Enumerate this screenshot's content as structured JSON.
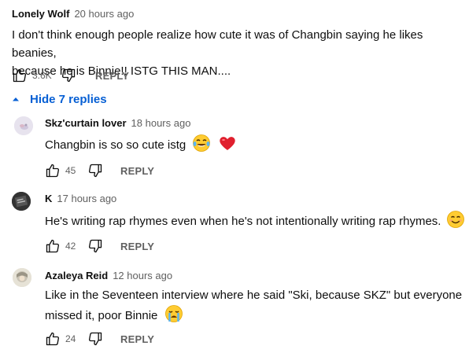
{
  "main_comment": {
    "author": "Lonely Wolf",
    "time": "20 hours ago",
    "text_line1": "I don't think enough people realize how cute it was of Changbin saying he likes beanies,",
    "text_line2": "because he is Binnie!! ISTG THIS MAN....",
    "likes": "3.6K",
    "reply_label": "REPLY"
  },
  "replies_toggle": {
    "label": "Hide 7 replies",
    "icon": "caret-up-icon"
  },
  "replies": [
    {
      "author": "Skz'curtain lover",
      "time": "18 hours ago",
      "text_line1": "Changbin is so so cute istg",
      "emojis": [
        "laughing-tears-emoji",
        "red-heart-emoji"
      ],
      "likes": "45",
      "reply_label": "REPLY"
    },
    {
      "author": "K",
      "time": "17 hours ago",
      "text_line1": "He's writing rap rhymes even when he's not intentionally writing rap rhymes.",
      "emojis": [
        "smiling-face-emoji"
      ],
      "likes": "42",
      "reply_label": "REPLY"
    },
    {
      "author": "Azaleya Reid",
      "time": "12 hours ago",
      "text_line1": "Like in the Seventeen interview where he said \"Ski, because SKZ\" but everyone",
      "text_line2": "missed it, poor Binnie",
      "emojis": [
        "crying-face-emoji"
      ],
      "likes": "24",
      "reply_label": "REPLY"
    }
  ],
  "colors": {
    "link": "#065fd4",
    "meta": "#606060",
    "text": "#0f0f0f"
  }
}
